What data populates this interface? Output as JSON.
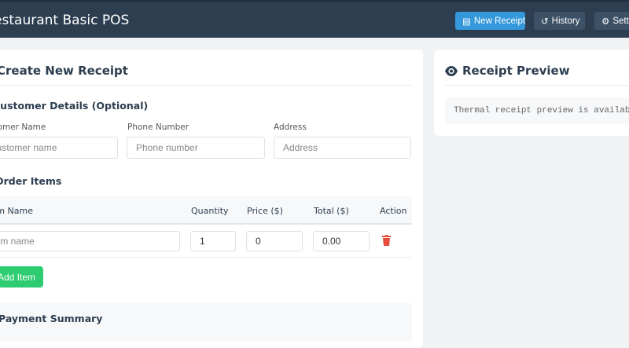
{
  "header": {
    "title": "Restaurant Basic POS",
    "buttons": [
      {
        "label": "New Receipt",
        "icon": "receipt-icon"
      },
      {
        "label": "History",
        "icon": "history-icon"
      },
      {
        "label": "Settings",
        "icon": "gear-icon"
      }
    ]
  },
  "form": {
    "title": "Create New Receipt",
    "customer_section": "Customer Details (Optional)",
    "fields": [
      {
        "label": "Customer Name",
        "placeholder": "Customer name"
      },
      {
        "label": "Phone Number",
        "placeholder": "Phone number"
      },
      {
        "label": "Address",
        "placeholder": "Address"
      }
    ],
    "order_section": "Order Items",
    "columns": [
      "Item Name",
      "Quantity",
      "Price ($)",
      "Total ($)",
      "Action"
    ],
    "rows": [
      {
        "name_placeholder": "Item name",
        "quantity": "1",
        "price": "0",
        "total": "0.00"
      }
    ],
    "add_item": "Add Item",
    "payment_section": "Payment Summary"
  },
  "preview": {
    "title": "Receipt Preview",
    "message": "Thermal receipt preview is available on desktop"
  },
  "colors": {
    "header": "#2c3e50",
    "primary": "#3498db",
    "success": "#2ecc71",
    "danger": "#e74c3c"
  }
}
